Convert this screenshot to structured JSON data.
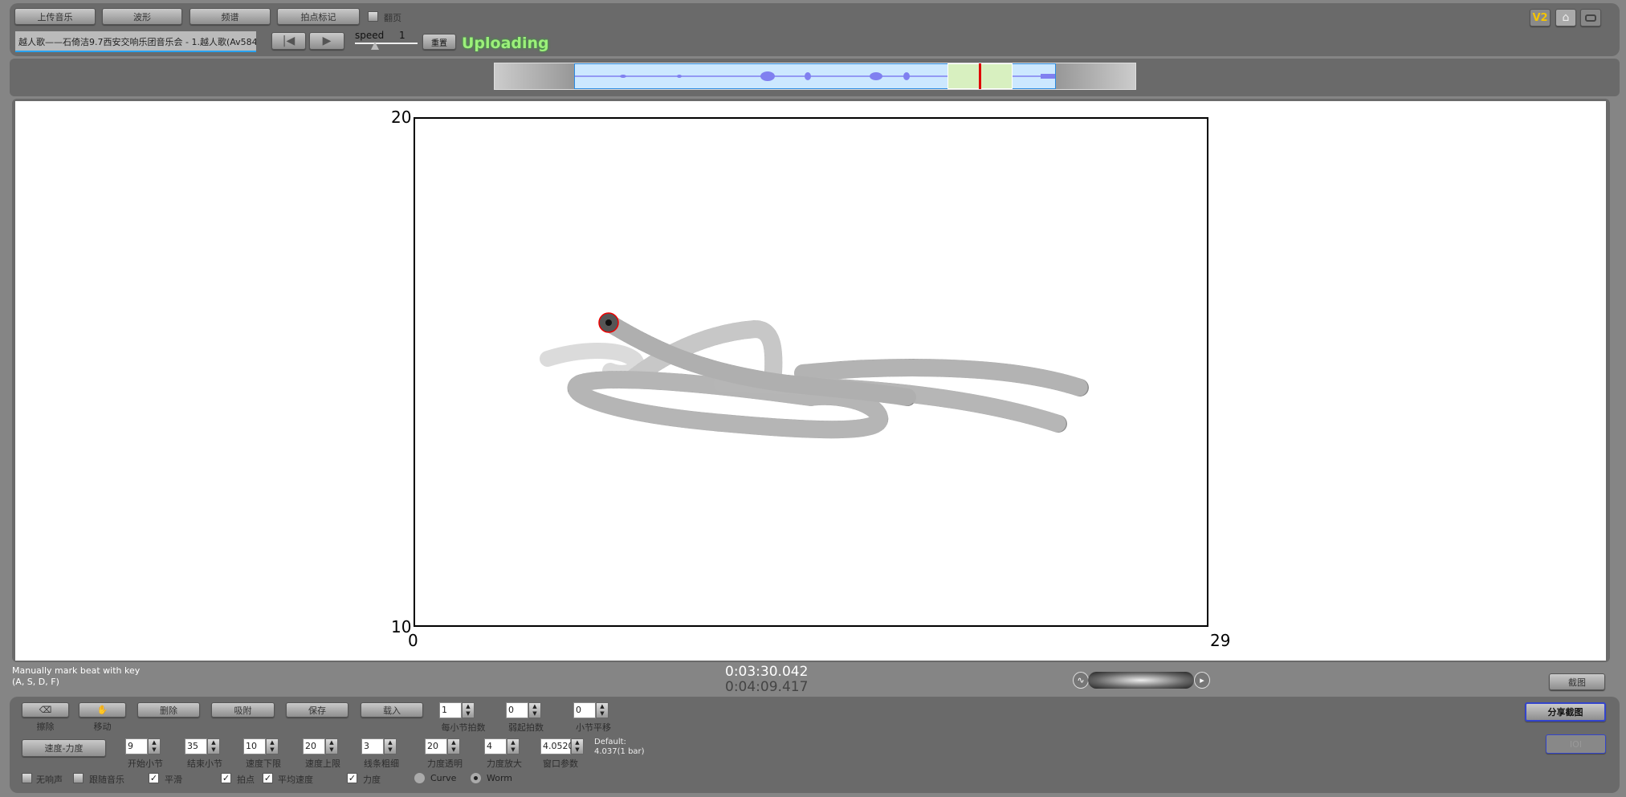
{
  "toolbar": {
    "upload": "上传音乐",
    "waveform": "波形",
    "spectrum": "频谱",
    "beat_mark": "拍点标记",
    "page_turn": "翻页",
    "page_turn_checked": false
  },
  "song": {
    "title": "越人歌——石倚洁9.7西安交响乐团音乐会 - 1.越人歌(Av584"
  },
  "transport": {
    "prev_icon": "skip-to-start-icon",
    "play_icon": "play-icon",
    "speed_label": "speed",
    "speed_value": "1",
    "reset": "重置",
    "status": "Uploading"
  },
  "top_right": {
    "version": "V2",
    "home_icon": "home-icon",
    "fullscreen_icon": "fullscreen-icon"
  },
  "overview": {
    "waveform_color": "#8080f0",
    "selection_color": "#cce8ff",
    "highlight_color": "#d8f0c0",
    "cursor_color": "#e00000"
  },
  "plot": {
    "y_max": "20",
    "y_min": "10",
    "x_min": "0",
    "x_max": "29"
  },
  "status": {
    "hint_line1": "Manually mark beat with key",
    "hint_line2": "(A, S, D, F)",
    "current_time": "0:03:30.042",
    "total_time": "0:04:09.417",
    "screenshot": "截图"
  },
  "controls": {
    "erase": "擦除",
    "move": "移动",
    "delete": "删除",
    "snap": "吸附",
    "save": "保存",
    "load": "载入",
    "beats_per_bar": {
      "value": "1",
      "label": "每小节拍数"
    },
    "pickup_beats": {
      "value": "0",
      "label": "弱起拍数"
    },
    "bar_shift": {
      "value": "0",
      "label": "小节平移"
    },
    "tempo_dynamics": "速度-力度",
    "start_bar": {
      "value": "9",
      "label": "开始小节"
    },
    "end_bar": {
      "value": "35",
      "label": "结束小节"
    },
    "tempo_min": {
      "value": "10",
      "label": "速度下限"
    },
    "tempo_max": {
      "value": "20",
      "label": "速度上限"
    },
    "line_width": {
      "value": "3",
      "label": "线条粗细"
    },
    "dyn_alpha": {
      "value": "20",
      "label": "力度透明"
    },
    "dyn_scale": {
      "value": "4",
      "label": "力度放大"
    },
    "window_param": {
      "value": "4.0520",
      "label": "窗口参数"
    },
    "default_line1": "Default:",
    "default_line2": "4.037(1 bar)",
    "share": "分享截图",
    "disabled_btn": "IOI",
    "checks": [
      {
        "label": "无响声",
        "checked": false
      },
      {
        "label": "跟随音乐",
        "checked": false
      },
      {
        "label": "平滑",
        "checked": true
      },
      {
        "label": "拍点",
        "checked": true
      },
      {
        "label": "平均速度",
        "checked": true
      },
      {
        "label": "力度",
        "checked": true
      }
    ],
    "radios": [
      {
        "label": "Curve",
        "selected": false
      },
      {
        "label": "Worm",
        "selected": true
      }
    ]
  }
}
